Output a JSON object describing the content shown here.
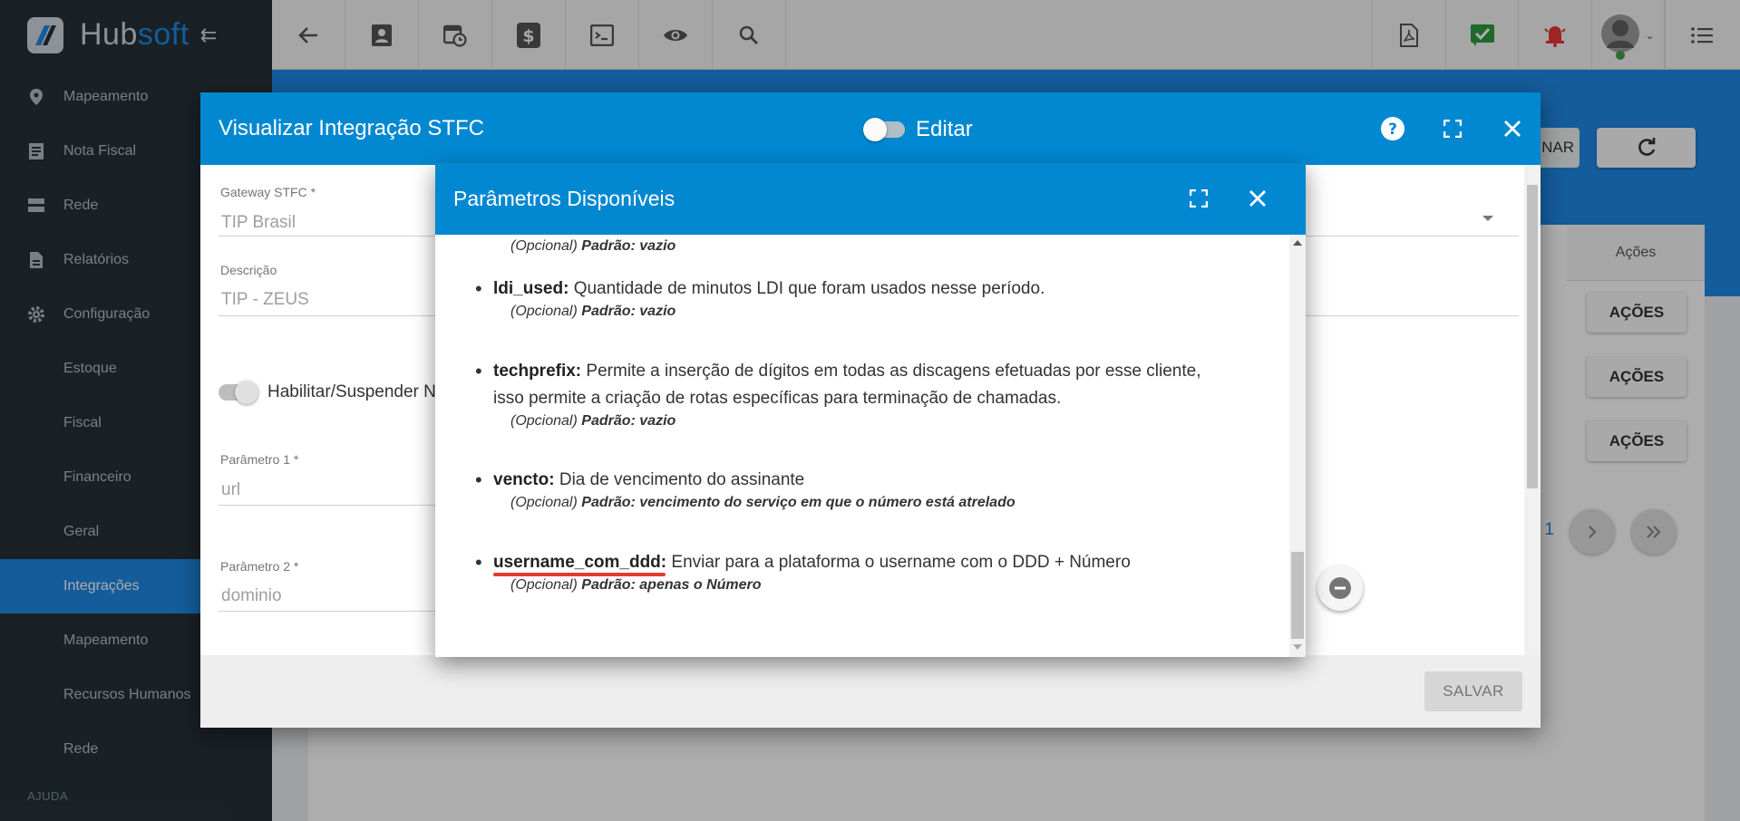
{
  "app": {
    "brand_hub": "Hub",
    "brand_soft": "soft",
    "accent_color": "#1e88e5",
    "header_color": "#0288d1"
  },
  "sidebar": {
    "items": [
      {
        "label": "Mapeamento",
        "icon": "map-pin-icon"
      },
      {
        "label": "Nota Fiscal",
        "icon": "receipt-icon"
      },
      {
        "label": "Rede",
        "icon": "server-icon"
      },
      {
        "label": "Relatórios",
        "icon": "document-icon"
      },
      {
        "label": "Configuração",
        "icon": "gear-icon"
      }
    ],
    "subitems": [
      {
        "label": "Estoque"
      },
      {
        "label": "Fiscal"
      },
      {
        "label": "Financeiro"
      },
      {
        "label": "Geral"
      },
      {
        "label": "Integrações",
        "active": true
      },
      {
        "label": "Mapeamento"
      },
      {
        "label": "Recursos Humanos"
      },
      {
        "label": "Rede"
      }
    ],
    "section_label": "AJUDA"
  },
  "background": {
    "nar_label": "NAR",
    "acoes_header": "Ações",
    "acoes_buttons": [
      "AÇÕES",
      "AÇÕES",
      "AÇÕES"
    ],
    "page_number": ": 1"
  },
  "outer_modal": {
    "title": "Visualizar Integração STFC",
    "edit_label": "Editar",
    "edit_enabled": false,
    "fields": {
      "gateway_label": "Gateway STFC *",
      "gateway_value": "TIP Brasil",
      "descricao_label": "Descrição",
      "descricao_value": "TIP - ZEUS",
      "habilitar_label": "Habilitar/Suspender N",
      "param1_label": "Parâmetro 1 *",
      "param1_value": "url",
      "param2_label": "Parâmetro 2 *",
      "param2_value": "dominio"
    },
    "save_label": "SALVAR"
  },
  "inner_modal": {
    "title": "Parâmetros Disponíveis",
    "partial_top": {
      "opt": "(Opcional)",
      "def": "Padrão: vazio"
    },
    "params": [
      {
        "key": "ldi_used:",
        "desc": "Quantidade de minutos LDI que foram usados nesse período.",
        "opt": "(Opcional)",
        "def": "Padrão: vazio"
      },
      {
        "key": "techprefix:",
        "desc": "Permite a inserção de dígitos em todas as discagens efetuadas por esse cliente,",
        "desc2": "isso permite a criação de rotas específicas para terminação de chamadas.",
        "opt": "(Opcional)",
        "def": "Padrão: vazio"
      },
      {
        "key": "vencto:",
        "desc": "Dia de vencimento do assinante",
        "opt": "(Opcional)",
        "def": "Padrão: vencimento do serviço em que o número está atrelado"
      },
      {
        "key": "username_com_ddd:",
        "desc": "Enviar para a plataforma o username com o DDD + Número",
        "opt": "(Opcional)",
        "def": "Padrão: apenas o Número",
        "highlighted": true
      }
    ]
  }
}
